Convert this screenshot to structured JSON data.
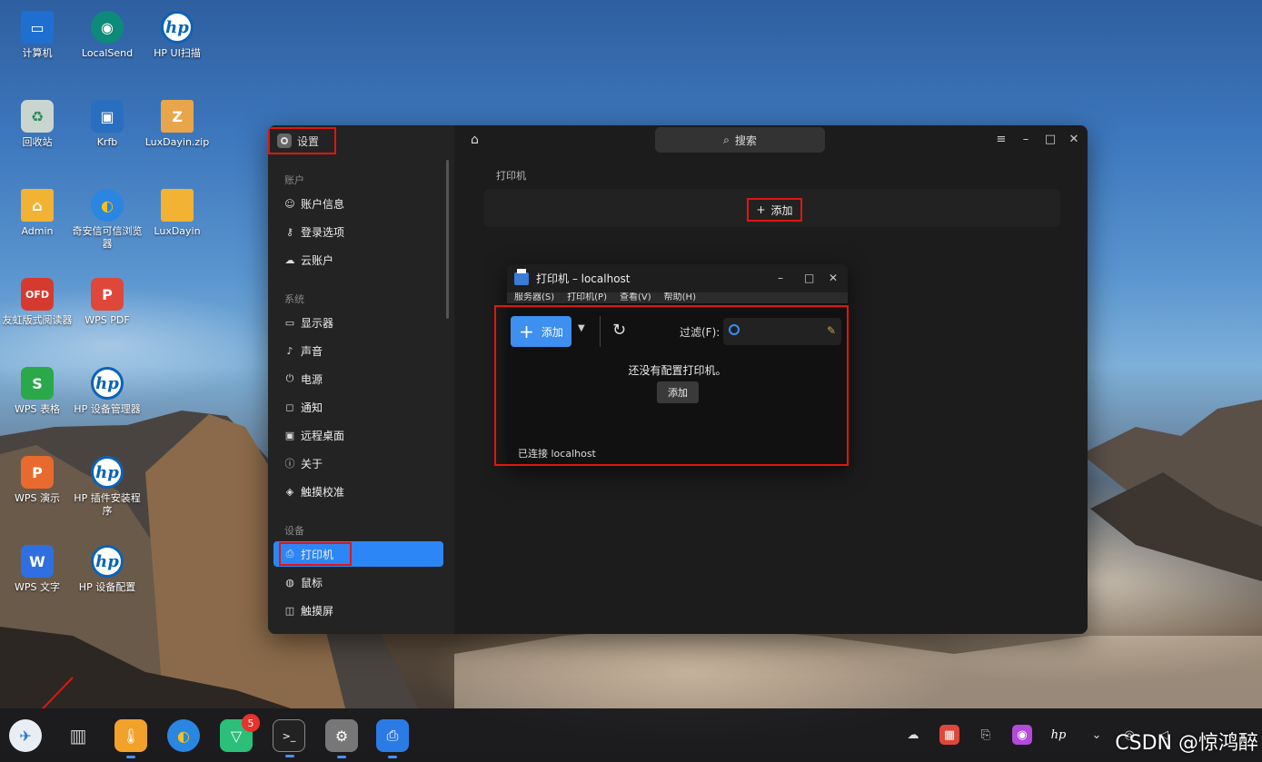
{
  "desktop": {
    "icons": [
      {
        "label": "计算机"
      },
      {
        "label": "LocalSend"
      },
      {
        "label": "HP UI扫描"
      },
      {
        "label": "回收站"
      },
      {
        "label": "Krfb"
      },
      {
        "label": "LuxDayin.zip"
      },
      {
        "label": "Admin"
      },
      {
        "label": "奇安信可信浏览器"
      },
      {
        "label": "LuxDayin"
      },
      {
        "label": "友虹版式阅读器"
      },
      {
        "label": "WPS PDF"
      },
      {
        "label": "WPS 表格"
      },
      {
        "label": "HP 设备管理器"
      },
      {
        "label": "WPS 演示"
      },
      {
        "label": "HP 插件安装程序"
      },
      {
        "label": "WPS 文字"
      },
      {
        "label": "HP 设备配置"
      }
    ]
  },
  "settings": {
    "title": "设置",
    "search_placeholder": "搜索",
    "page_title": "打印机",
    "add_label": "添加",
    "sections": {
      "account": "账户",
      "system": "系统",
      "devices": "设备"
    },
    "nav": {
      "account_info": "账户信息",
      "login": "登录选项",
      "cloud": "云账户",
      "display": "显示器",
      "sound": "声音",
      "power": "电源",
      "notify": "通知",
      "remote": "远程桌面",
      "about": "关于",
      "touch_calib": "触摸校准",
      "printer": "打印机",
      "mouse": "鼠标",
      "touchscreen": "触摸屏"
    }
  },
  "printer_dialog": {
    "title": "打印机 – localhost",
    "menu": [
      "服务器(S)",
      "打印机(P)",
      "查看(V)",
      "帮助(H)"
    ],
    "add_label": "添加",
    "filter_label": "过滤(F):",
    "empty_message": "还没有配置打印机。",
    "empty_add": "添加",
    "status": "已连接 localhost"
  },
  "taskbar": {
    "badge_count": "5"
  },
  "watermark": "CSDN @惊鸿醉"
}
